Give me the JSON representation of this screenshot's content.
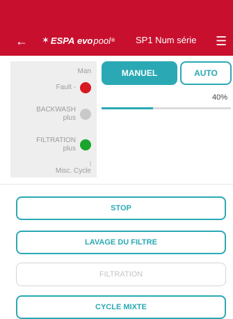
{
  "appbar": {
    "back_icon": "arrow-left-icon",
    "logo": {
      "symbol": "✶",
      "brand": "ESPA",
      "evo": "evo",
      "pool": "pool",
      "reg": "®"
    },
    "title": "SP1 Num série",
    "menu_icon": "hamburger-menu-icon"
  },
  "status_panel": {
    "mode_label": "Man",
    "fault_label": "Fault",
    "backwash_label_1": "BACKWASH",
    "backwash_label_2": "plus",
    "filtration_label_1": "FILTRATION",
    "filtration_label_2": "plus",
    "misc_label": "Misc. Cycle",
    "colors": {
      "fault": "#d71921",
      "backwash": "#c9c9c9",
      "filtration": "#1aa52c"
    }
  },
  "mode": {
    "manual_label": "MANUEL",
    "auto_label": "AUTO",
    "active": "MANUEL",
    "percent_text": "40%",
    "progress_fraction": 0.4
  },
  "actions": {
    "stop": "STOP",
    "backwash": "LAVAGE DU FILTRE",
    "filtration": "FILTRATION",
    "mixed_cycle": "CYCLE MIXTE"
  },
  "colors": {
    "brand": "#c8102e",
    "accent": "#2aa9b5"
  }
}
